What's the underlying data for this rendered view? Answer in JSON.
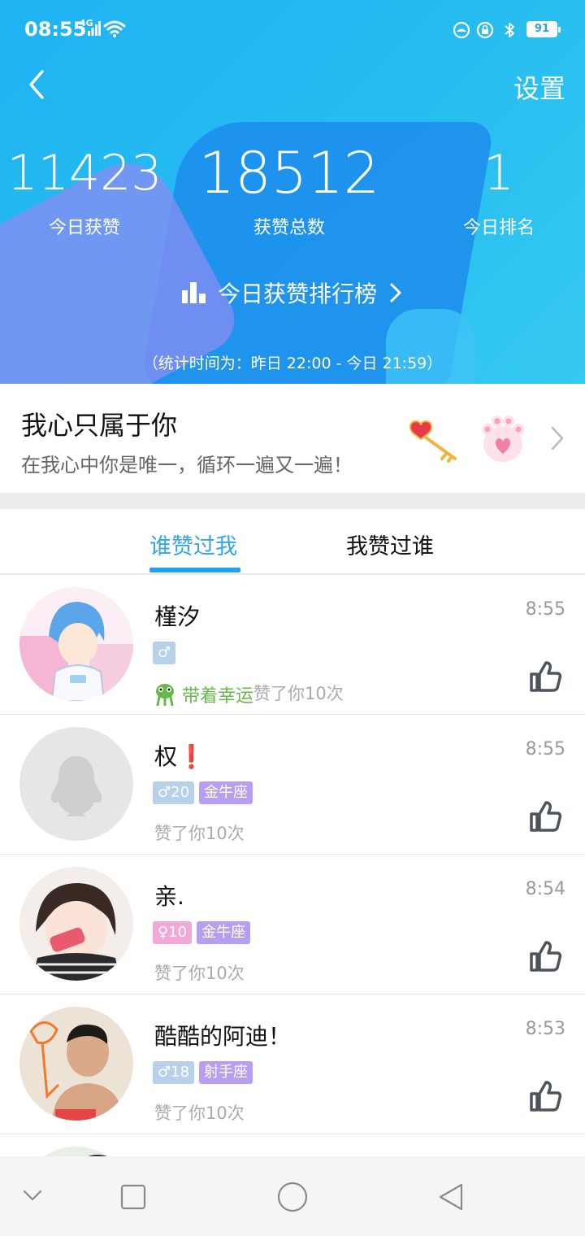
{
  "status_bar": {
    "time": "08:55",
    "network": "4G",
    "battery": "91"
  },
  "header": {
    "settings_label": "设置",
    "stats": [
      {
        "value": "11423",
        "label": "今日获赞"
      },
      {
        "value": "18512",
        "label": "获赞总数"
      },
      {
        "value": "1",
        "label": "今日排名"
      }
    ],
    "rank_link": "今日获赞排行榜",
    "stat_period": "（统计时间为：昨日 22:00 - 今日 21:59）"
  },
  "banner": {
    "title": "我心只属于你",
    "subtitle": "在我心中你是唯一，循环一遍又一遍！"
  },
  "tabs": [
    {
      "label": "谁赞过我",
      "active": true
    },
    {
      "label": "我赞过谁",
      "active": false
    }
  ],
  "list": [
    {
      "name": "槿汐",
      "time": "8:55",
      "tags": [
        "♂"
      ],
      "luck_label": "带着幸运",
      "likes_text": "赞了你10次"
    },
    {
      "name": "权❗",
      "time": "8:55",
      "tags": [
        "♂20",
        "金牛座"
      ],
      "likes_text": "赞了你10次"
    },
    {
      "name": "亲.",
      "time": "8:54",
      "tags": [
        "♀10",
        "金牛座"
      ],
      "likes_text": "赞了你10次"
    },
    {
      "name": "酷酷的阿迪！",
      "time": "8:53",
      "tags": [
        "♂18",
        "射手座"
      ],
      "likes_text": "赞了你10次"
    }
  ],
  "colors": {
    "header_blue": "#1fb3f2",
    "tab_active": "#33a5e8",
    "luck_green": "#67b84a",
    "male_tag": "#b7d1ea",
    "female_tag": "#f2a9d8",
    "astro_tag": "#b79ef0"
  },
  "icons": [
    "back-icon",
    "signal-icon",
    "wifi-icon",
    "bar-chart-icon",
    "chevron-right-icon",
    "key-icon",
    "paw-icon",
    "thumbs-up-icon",
    "frog-icon",
    "nav-down-icon",
    "nav-square-icon",
    "nav-circle-icon",
    "nav-back-triangle-icon"
  ]
}
